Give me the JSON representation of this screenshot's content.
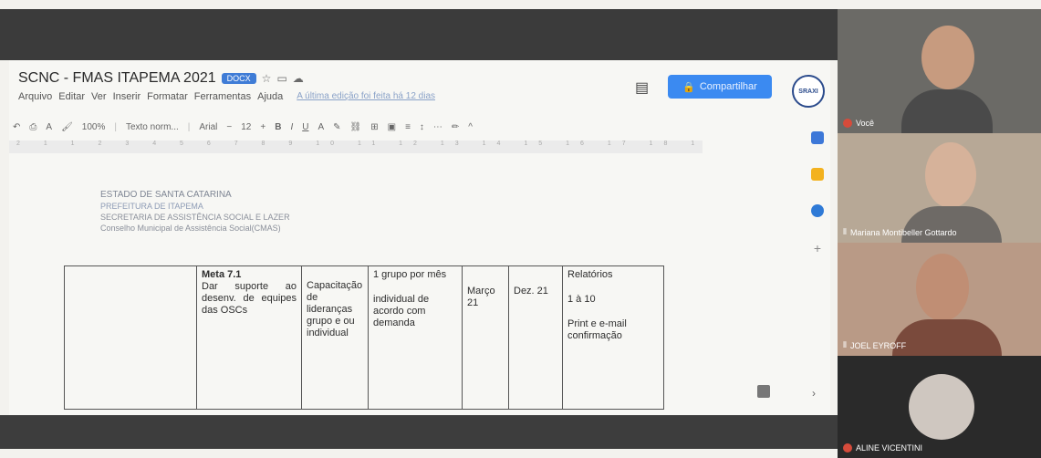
{
  "doc": {
    "title": "SCNC - FMAS ITAPEMA 2021",
    "badge": "DOCX",
    "menu": [
      "Arquivo",
      "Editar",
      "Ver",
      "Inserir",
      "Formatar",
      "Ferramentas",
      "Ajuda"
    ],
    "last_edit": "A última edição foi feita há 12 dias",
    "share_label": "Compartilhar",
    "avatar_text": "SRAXI",
    "toolbar": {
      "zoom": "100%",
      "style": "Texto norm...",
      "font": "Arial",
      "size": "12"
    },
    "ruler_text": "2 1 1 2 3 4 5 6 7 8 9 10 11 12 13 14 15 16 17 18 19"
  },
  "letterhead": {
    "line1": "ESTADO DE SANTA CATARINA",
    "line2": "PREFEITURA DE ITAPEMA",
    "line3": "SECRETARIA DE ASSISTÊNCIA SOCIAL E LAZER",
    "line4": "Conselho Municipal de Assistência Social(CMAS)"
  },
  "table": {
    "meta_title": "Meta 7.1",
    "meta_text": "Dar suporte ao desenv. de equipes das OSCs",
    "col3": "Capacitação de lideranças grupo e ou individual",
    "col4_a": "1 grupo por mês",
    "col4_b": "individual de acordo com demanda",
    "col5": "Março 21",
    "col6": "Dez. 21",
    "col7_a": "Relatórios",
    "col7_b": "1 à 10",
    "col7_c": "Print e e-mail confirmação"
  },
  "participants": [
    {
      "name": "Você"
    },
    {
      "name": "Mariana Montibeller Gottardo"
    },
    {
      "name": "JOEL EYROFF"
    },
    {
      "name": "ALINE VICENTINI"
    }
  ]
}
